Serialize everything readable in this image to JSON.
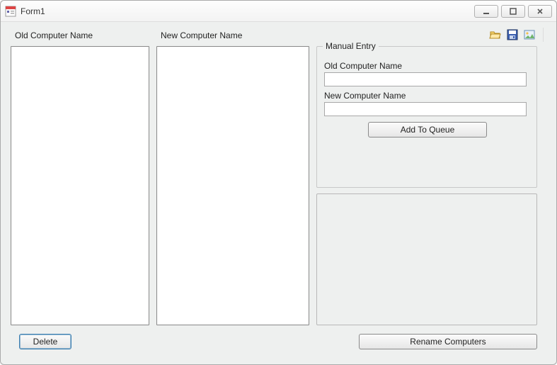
{
  "window": {
    "title": "Form1"
  },
  "labels": {
    "old_list": "Old Computer Name",
    "new_list": "New Computer Name"
  },
  "manual": {
    "legend": "Manual Entry",
    "old_label": "Old Computer Name",
    "old_value": "",
    "new_label": "New Computer Name",
    "new_value": "",
    "add_button": "Add To Queue"
  },
  "buttons": {
    "delete": "Delete",
    "rename": "Rename Computers"
  },
  "icons": {
    "open": "folder-open-icon",
    "save": "save-icon",
    "image": "image-icon"
  }
}
